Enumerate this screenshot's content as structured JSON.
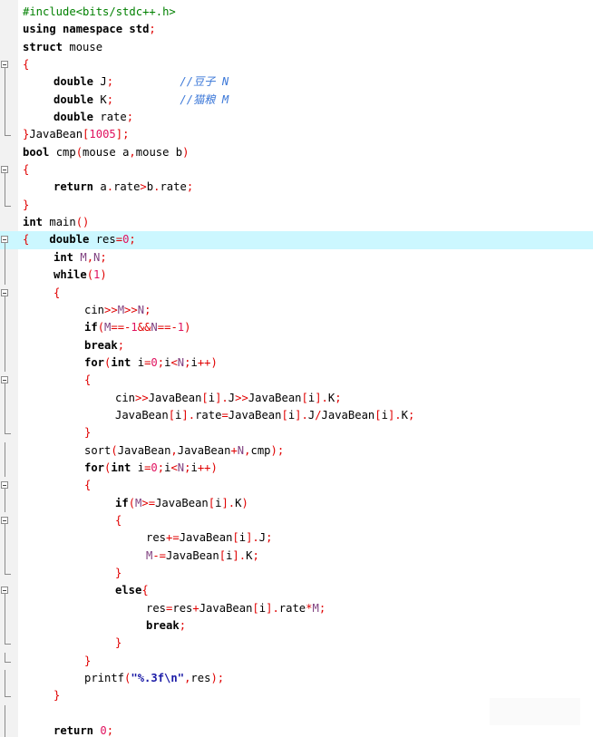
{
  "editor": {
    "lines": [
      {
        "indent": 0,
        "parts": [
          {
            "t": "#include<bits/stdc++.h>",
            "c": "pp"
          }
        ]
      },
      {
        "indent": 0,
        "parts": [
          {
            "t": "using namespace std",
            "c": "kw"
          },
          {
            "t": ";",
            "c": "op"
          }
        ]
      },
      {
        "indent": 0,
        "parts": [
          {
            "t": "struct ",
            "c": "kw"
          },
          {
            "t": "mouse",
            "c": "id"
          }
        ]
      },
      {
        "indent": 0,
        "parts": [
          {
            "t": "{",
            "c": "op"
          }
        ]
      },
      {
        "indent": 1,
        "parts": [
          {
            "t": "double ",
            "c": "kw"
          },
          {
            "t": "J",
            "c": "id"
          },
          {
            "t": ";",
            "c": "op"
          },
          {
            "t": "          //豆子 N",
            "c": "cmt"
          }
        ]
      },
      {
        "indent": 1,
        "parts": [
          {
            "t": "double ",
            "c": "kw"
          },
          {
            "t": "K",
            "c": "id"
          },
          {
            "t": ";",
            "c": "op"
          },
          {
            "t": "          //猫粮 M",
            "c": "cmt"
          }
        ]
      },
      {
        "indent": 1,
        "parts": [
          {
            "t": "double ",
            "c": "kw"
          },
          {
            "t": "rate",
            "c": "id"
          },
          {
            "t": ";",
            "c": "op"
          }
        ]
      },
      {
        "indent": 0,
        "parts": [
          {
            "t": "}",
            "c": "op"
          },
          {
            "t": "JavaBean",
            "c": "id"
          },
          {
            "t": "[",
            "c": "op"
          },
          {
            "t": "1005",
            "c": "num"
          },
          {
            "t": "];",
            "c": "op"
          }
        ]
      },
      {
        "indent": 0,
        "parts": [
          {
            "t": "bool ",
            "c": "kw"
          },
          {
            "t": "cmp",
            "c": "id"
          },
          {
            "t": "(",
            "c": "op"
          },
          {
            "t": "mouse a",
            "c": "id"
          },
          {
            "t": ",",
            "c": "op"
          },
          {
            "t": "mouse b",
            "c": "id"
          },
          {
            "t": ")",
            "c": "op"
          }
        ]
      },
      {
        "indent": 0,
        "parts": [
          {
            "t": "{",
            "c": "op"
          }
        ]
      },
      {
        "indent": 1,
        "parts": [
          {
            "t": "return ",
            "c": "kw"
          },
          {
            "t": "a",
            "c": "id"
          },
          {
            "t": ".",
            "c": "op"
          },
          {
            "t": "rate",
            "c": "id"
          },
          {
            "t": ">",
            "c": "op"
          },
          {
            "t": "b",
            "c": "id"
          },
          {
            "t": ".",
            "c": "op"
          },
          {
            "t": "rate",
            "c": "id"
          },
          {
            "t": ";",
            "c": "op"
          }
        ]
      },
      {
        "indent": 0,
        "parts": [
          {
            "t": "}",
            "c": "op"
          }
        ]
      },
      {
        "indent": 0,
        "parts": [
          {
            "t": "int ",
            "c": "kw"
          },
          {
            "t": "main",
            "c": "id"
          },
          {
            "t": "()",
            "c": "op"
          }
        ]
      },
      {
        "indent": 0,
        "current": true,
        "parts": [
          {
            "t": "{",
            "c": "op"
          },
          {
            "t": "   double ",
            "c": "kw"
          },
          {
            "t": "res",
            "c": "id"
          },
          {
            "t": "=",
            "c": "op"
          },
          {
            "t": "0",
            "c": "num"
          },
          {
            "t": ";",
            "c": "op"
          }
        ]
      },
      {
        "indent": 1,
        "parts": [
          {
            "t": "int ",
            "c": "kw"
          },
          {
            "t": "M",
            "c": "vr"
          },
          {
            "t": ",",
            "c": "op"
          },
          {
            "t": "N",
            "c": "vr"
          },
          {
            "t": ";",
            "c": "op"
          }
        ]
      },
      {
        "indent": 1,
        "parts": [
          {
            "t": "while",
            "c": "kw"
          },
          {
            "t": "(",
            "c": "op"
          },
          {
            "t": "1",
            "c": "num"
          },
          {
            "t": ")",
            "c": "op"
          }
        ]
      },
      {
        "indent": 1,
        "parts": [
          {
            "t": "{",
            "c": "op"
          }
        ]
      },
      {
        "indent": 2,
        "parts": [
          {
            "t": "cin",
            "c": "id"
          },
          {
            "t": ">>",
            "c": "op"
          },
          {
            "t": "M",
            "c": "vr"
          },
          {
            "t": ">>",
            "c": "op"
          },
          {
            "t": "N",
            "c": "vr"
          },
          {
            "t": ";",
            "c": "op"
          }
        ]
      },
      {
        "indent": 2,
        "parts": [
          {
            "t": "if",
            "c": "kw"
          },
          {
            "t": "(",
            "c": "op"
          },
          {
            "t": "M",
            "c": "vr"
          },
          {
            "t": "==-",
            "c": "op"
          },
          {
            "t": "1",
            "c": "num"
          },
          {
            "t": "&&",
            "c": "op"
          },
          {
            "t": "N",
            "c": "vr"
          },
          {
            "t": "==-",
            "c": "op"
          },
          {
            "t": "1",
            "c": "num"
          },
          {
            "t": ")",
            "c": "op"
          }
        ]
      },
      {
        "indent": 2,
        "parts": [
          {
            "t": "break",
            "c": "kw"
          },
          {
            "t": ";",
            "c": "op"
          }
        ]
      },
      {
        "indent": 2,
        "parts": [
          {
            "t": "for",
            "c": "kw"
          },
          {
            "t": "(",
            "c": "op"
          },
          {
            "t": "int ",
            "c": "kw"
          },
          {
            "t": "i",
            "c": "id"
          },
          {
            "t": "=",
            "c": "op"
          },
          {
            "t": "0",
            "c": "num"
          },
          {
            "t": ";",
            "c": "op"
          },
          {
            "t": "i",
            "c": "id"
          },
          {
            "t": "<",
            "c": "op"
          },
          {
            "t": "N",
            "c": "vr"
          },
          {
            "t": ";",
            "c": "op"
          },
          {
            "t": "i",
            "c": "id"
          },
          {
            "t": "++)",
            "c": "op"
          }
        ]
      },
      {
        "indent": 2,
        "parts": [
          {
            "t": "{",
            "c": "op"
          }
        ]
      },
      {
        "indent": 3,
        "parts": [
          {
            "t": "cin",
            "c": "id"
          },
          {
            "t": ">>",
            "c": "op"
          },
          {
            "t": "JavaBean",
            "c": "id"
          },
          {
            "t": "[",
            "c": "op"
          },
          {
            "t": "i",
            "c": "id"
          },
          {
            "t": "].",
            "c": "op"
          },
          {
            "t": "J",
            "c": "id"
          },
          {
            "t": ">>",
            "c": "op"
          },
          {
            "t": "JavaBean",
            "c": "id"
          },
          {
            "t": "[",
            "c": "op"
          },
          {
            "t": "i",
            "c": "id"
          },
          {
            "t": "].",
            "c": "op"
          },
          {
            "t": "K",
            "c": "id"
          },
          {
            "t": ";",
            "c": "op"
          }
        ]
      },
      {
        "indent": 3,
        "parts": [
          {
            "t": "JavaBean",
            "c": "id"
          },
          {
            "t": "[",
            "c": "op"
          },
          {
            "t": "i",
            "c": "id"
          },
          {
            "t": "].",
            "c": "op"
          },
          {
            "t": "rate",
            "c": "id"
          },
          {
            "t": "=",
            "c": "op"
          },
          {
            "t": "JavaBean",
            "c": "id"
          },
          {
            "t": "[",
            "c": "op"
          },
          {
            "t": "i",
            "c": "id"
          },
          {
            "t": "].",
            "c": "op"
          },
          {
            "t": "J",
            "c": "id"
          },
          {
            "t": "/",
            "c": "op"
          },
          {
            "t": "JavaBean",
            "c": "id"
          },
          {
            "t": "[",
            "c": "op"
          },
          {
            "t": "i",
            "c": "id"
          },
          {
            "t": "].",
            "c": "op"
          },
          {
            "t": "K",
            "c": "id"
          },
          {
            "t": ";",
            "c": "op"
          }
        ]
      },
      {
        "indent": 2,
        "parts": [
          {
            "t": "}",
            "c": "op"
          }
        ]
      },
      {
        "indent": 2,
        "parts": [
          {
            "t": "sort",
            "c": "id"
          },
          {
            "t": "(",
            "c": "op"
          },
          {
            "t": "JavaBean",
            "c": "id"
          },
          {
            "t": ",",
            "c": "op"
          },
          {
            "t": "JavaBean",
            "c": "id"
          },
          {
            "t": "+",
            "c": "op"
          },
          {
            "t": "N",
            "c": "vr"
          },
          {
            "t": ",",
            "c": "op"
          },
          {
            "t": "cmp",
            "c": "id"
          },
          {
            "t": ");",
            "c": "op"
          }
        ]
      },
      {
        "indent": 2,
        "parts": [
          {
            "t": "for",
            "c": "kw"
          },
          {
            "t": "(",
            "c": "op"
          },
          {
            "t": "int ",
            "c": "kw"
          },
          {
            "t": "i",
            "c": "id"
          },
          {
            "t": "=",
            "c": "op"
          },
          {
            "t": "0",
            "c": "num"
          },
          {
            "t": ";",
            "c": "op"
          },
          {
            "t": "i",
            "c": "id"
          },
          {
            "t": "<",
            "c": "op"
          },
          {
            "t": "N",
            "c": "vr"
          },
          {
            "t": ";",
            "c": "op"
          },
          {
            "t": "i",
            "c": "id"
          },
          {
            "t": "++)",
            "c": "op"
          }
        ]
      },
      {
        "indent": 2,
        "parts": [
          {
            "t": "{",
            "c": "op"
          }
        ]
      },
      {
        "indent": 3,
        "parts": [
          {
            "t": "if",
            "c": "kw"
          },
          {
            "t": "(",
            "c": "op"
          },
          {
            "t": "M",
            "c": "vr"
          },
          {
            "t": ">=",
            "c": "op"
          },
          {
            "t": "JavaBean",
            "c": "id"
          },
          {
            "t": "[",
            "c": "op"
          },
          {
            "t": "i",
            "c": "id"
          },
          {
            "t": "].",
            "c": "op"
          },
          {
            "t": "K",
            "c": "id"
          },
          {
            "t": ")",
            "c": "op"
          }
        ]
      },
      {
        "indent": 3,
        "parts": [
          {
            "t": "{",
            "c": "op"
          }
        ]
      },
      {
        "indent": 4,
        "parts": [
          {
            "t": "res",
            "c": "id"
          },
          {
            "t": "+=",
            "c": "op"
          },
          {
            "t": "JavaBean",
            "c": "id"
          },
          {
            "t": "[",
            "c": "op"
          },
          {
            "t": "i",
            "c": "id"
          },
          {
            "t": "].",
            "c": "op"
          },
          {
            "t": "J",
            "c": "id"
          },
          {
            "t": ";",
            "c": "op"
          }
        ]
      },
      {
        "indent": 4,
        "parts": [
          {
            "t": "M",
            "c": "vr"
          },
          {
            "t": "-=",
            "c": "op"
          },
          {
            "t": "JavaBean",
            "c": "id"
          },
          {
            "t": "[",
            "c": "op"
          },
          {
            "t": "i",
            "c": "id"
          },
          {
            "t": "].",
            "c": "op"
          },
          {
            "t": "K",
            "c": "id"
          },
          {
            "t": ";",
            "c": "op"
          }
        ]
      },
      {
        "indent": 3,
        "parts": [
          {
            "t": "}",
            "c": "op"
          }
        ]
      },
      {
        "indent": 3,
        "parts": [
          {
            "t": "else",
            "c": "kw"
          },
          {
            "t": "{",
            "c": "op"
          }
        ]
      },
      {
        "indent": 4,
        "parts": [
          {
            "t": "res",
            "c": "id"
          },
          {
            "t": "=",
            "c": "op"
          },
          {
            "t": "res",
            "c": "id"
          },
          {
            "t": "+",
            "c": "op"
          },
          {
            "t": "JavaBean",
            "c": "id"
          },
          {
            "t": "[",
            "c": "op"
          },
          {
            "t": "i",
            "c": "id"
          },
          {
            "t": "].",
            "c": "op"
          },
          {
            "t": "rate",
            "c": "id"
          },
          {
            "t": "*",
            "c": "op"
          },
          {
            "t": "M",
            "c": "vr"
          },
          {
            "t": ";",
            "c": "op"
          }
        ]
      },
      {
        "indent": 4,
        "parts": [
          {
            "t": "break",
            "c": "kw"
          },
          {
            "t": ";",
            "c": "op"
          }
        ]
      },
      {
        "indent": 3,
        "parts": [
          {
            "t": "}",
            "c": "op"
          }
        ]
      },
      {
        "indent": 2,
        "parts": [
          {
            "t": "}",
            "c": "op"
          }
        ]
      },
      {
        "indent": 2,
        "parts": [
          {
            "t": "printf",
            "c": "id"
          },
          {
            "t": "(",
            "c": "op"
          },
          {
            "t": "\"%.3f\\n\"",
            "c": "str"
          },
          {
            "t": ",",
            "c": "op"
          },
          {
            "t": "res",
            "c": "id"
          },
          {
            "t": ");",
            "c": "op"
          }
        ]
      },
      {
        "indent": 1,
        "parts": [
          {
            "t": "}",
            "c": "op"
          }
        ]
      },
      {
        "indent": 0,
        "parts": []
      },
      {
        "indent": 1,
        "parts": [
          {
            "t": "return ",
            "c": "kw"
          },
          {
            "t": "0",
            "c": "num"
          },
          {
            "t": ";",
            "c": "op"
          }
        ]
      },
      {
        "indent": 0,
        "parts": [
          {
            "t": "}",
            "c": "op"
          }
        ]
      }
    ],
    "folds": [
      "none",
      "none",
      "none",
      "box",
      "line",
      "line",
      "line",
      "end",
      "none",
      "box",
      "line",
      "end",
      "none",
      "box",
      "line",
      "line",
      "box",
      "line",
      "line",
      "line",
      "line",
      "box",
      "line",
      "line",
      "end",
      "line",
      "line",
      "box",
      "line",
      "box",
      "line",
      "line",
      "end",
      "box",
      "line",
      "line",
      "end",
      "end",
      "line",
      "end",
      "line",
      "line",
      "end"
    ],
    "colors": {
      "keyword": "#000000",
      "preprocessor": "#008000",
      "number": "#e0105e",
      "operator": "#e00000",
      "string": "#1a1aa6",
      "comment": "#3c78d8",
      "current_line": "#ccf7ff",
      "gutter": "#f2f2f2"
    }
  }
}
